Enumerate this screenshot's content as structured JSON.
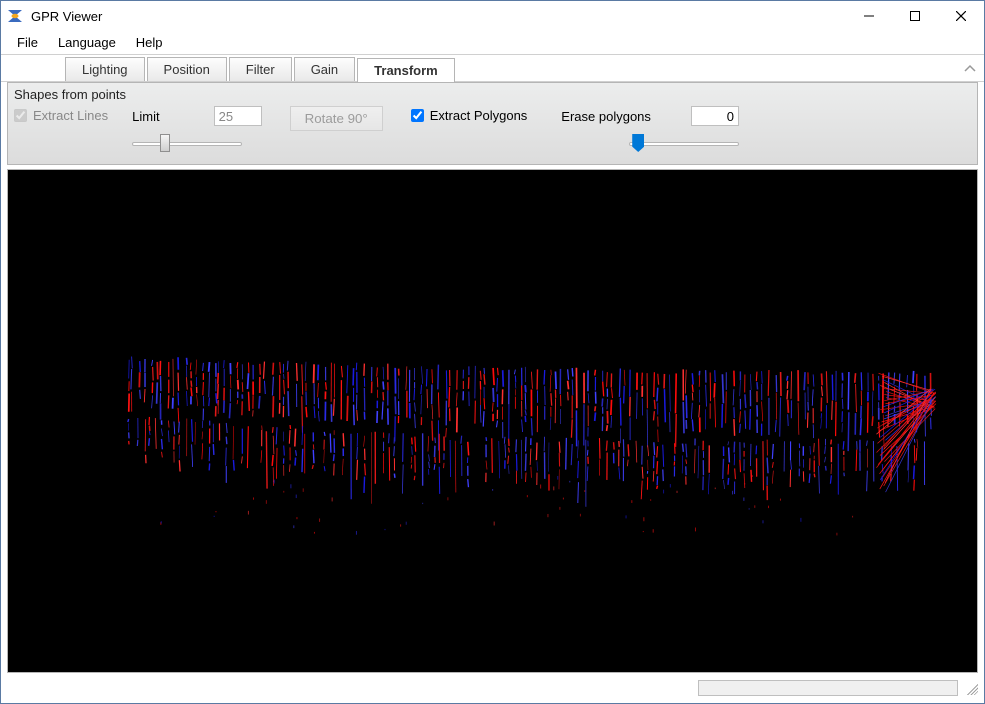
{
  "window": {
    "title": "GPR Viewer"
  },
  "menubar": {
    "items": [
      "File",
      "Language",
      "Help"
    ]
  },
  "tabs": {
    "items": [
      "Lighting",
      "Position",
      "Filter",
      "Gain",
      "Transform"
    ],
    "active_index": 4
  },
  "panel": {
    "title": "Shapes from points",
    "extract_lines": {
      "label": "Extract Lines",
      "checked": true,
      "enabled": false
    },
    "limit": {
      "label": "Limit",
      "value": "25",
      "enabled": false,
      "slider_pos_pct": 25
    },
    "rotate_button": {
      "label": "Rotate 90°",
      "enabled": false
    },
    "extract_polygons": {
      "label": "Extract Polygons",
      "checked": true,
      "enabled": true
    },
    "erase_polygons": {
      "label": "Erase polygons",
      "value": "0",
      "slider_pos_pct": 3
    }
  }
}
